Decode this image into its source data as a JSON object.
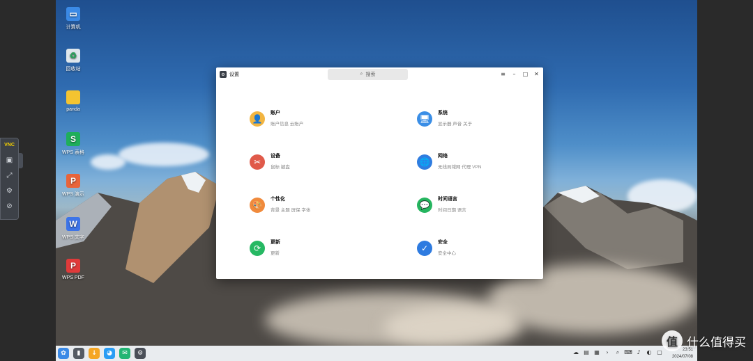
{
  "desktop": {
    "icons": [
      {
        "label": "计算机",
        "icon": "computer-icon",
        "color": "#3b8ae6",
        "glyph": "▭"
      },
      {
        "label": "回收站",
        "icon": "trash-icon",
        "color": "#dfe7ec",
        "glyph": "♻"
      },
      {
        "label": "panda",
        "icon": "folder-icon",
        "color": "#f4c430",
        "glyph": ""
      },
      {
        "label": "WPS 表格",
        "icon": "wps-sheets-icon",
        "color": "#1fae5a",
        "glyph": "S"
      },
      {
        "label": "WPS 演示",
        "icon": "wps-slides-icon",
        "color": "#e8643a",
        "glyph": "P"
      },
      {
        "label": "WPS 文字",
        "icon": "wps-writer-icon",
        "color": "#3d74e8",
        "glyph": "W"
      },
      {
        "label": "WPS PDF",
        "icon": "wps-pdf-icon",
        "color": "#e03a3a",
        "glyph": "P"
      }
    ]
  },
  "vnc": {
    "logo": "VNC",
    "buttons": [
      "screen-icon",
      "scale-icon",
      "gear-icon",
      "disconnect-icon"
    ]
  },
  "window": {
    "title": "设置",
    "search_placeholder": "搜索",
    "controls": {
      "menu": "≡",
      "minimize": "–",
      "maximize": "□",
      "close": "✕"
    },
    "categories": [
      {
        "title": "账户",
        "subtitle": "账户信息  云账户",
        "icon": "account-icon",
        "color": "#f2b541",
        "glyph": "👤"
      },
      {
        "title": "系统",
        "subtitle": "显示器  声音  关于",
        "icon": "system-icon",
        "color": "#3a8ee6",
        "glyph": "🖥"
      },
      {
        "title": "设备",
        "subtitle": "鼠标  键盘",
        "icon": "device-icon",
        "color": "#e05a4a",
        "glyph": "✂"
      },
      {
        "title": "网络",
        "subtitle": "无线局域网  代理  VPN",
        "icon": "network-icon",
        "color": "#2f7de0",
        "glyph": "🌐"
      },
      {
        "title": "个性化",
        "subtitle": "背景  主题  屏保  字体",
        "icon": "personalize-icon",
        "color": "#f08a3c",
        "glyph": "🎨"
      },
      {
        "title": "时间语言",
        "subtitle": "时间日期  语言",
        "icon": "time-language-icon",
        "color": "#25b55f",
        "glyph": "💬"
      },
      {
        "title": "更新",
        "subtitle": "更新",
        "icon": "update-icon",
        "color": "#26b863",
        "glyph": "⟳"
      },
      {
        "title": "安全",
        "subtitle": "安全中心",
        "icon": "security-icon",
        "color": "#2e7be0",
        "glyph": "✓"
      }
    ]
  },
  "taskbar": {
    "apps": [
      {
        "icon": "start-menu-icon",
        "color": "#3b8ae6",
        "glyph": "✿"
      },
      {
        "icon": "file-manager-icon",
        "color": "#555b63",
        "glyph": "▮"
      },
      {
        "icon": "app-store-icon",
        "color": "#f5a623",
        "glyph": "↓"
      },
      {
        "icon": "browser-icon",
        "color": "#2a9df4",
        "glyph": "◕"
      },
      {
        "icon": "mail-icon",
        "color": "#22b573",
        "glyph": "✉"
      },
      {
        "icon": "settings-app-icon",
        "color": "#4a4f58",
        "glyph": "⚙"
      }
    ],
    "tray": [
      "cloud-icon",
      "clipboard-icon",
      "color-palette-icon",
      "chevron-right-icon",
      "search-icon",
      "keyboard-icon",
      "volume-icon",
      "network-icon",
      "notification-icon"
    ],
    "time": "23:51",
    "date": "2024/07/08"
  },
  "watermark": {
    "text": "什么值得买",
    "logo": "值"
  }
}
